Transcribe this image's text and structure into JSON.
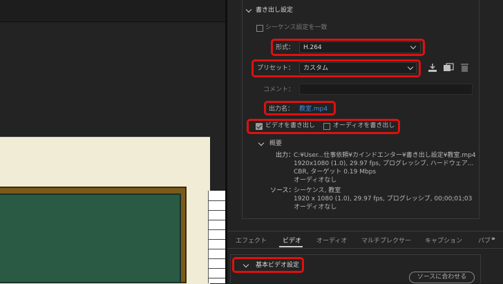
{
  "export_settings": {
    "section_title": "書き出し設定",
    "match_sequence_label": "シーケンス設定を一致",
    "format": {
      "label": "形式：",
      "value": "H.264"
    },
    "preset": {
      "label": "プリセット：",
      "value": "カスタム"
    },
    "comment": {
      "label": "コメント：",
      "value": ""
    },
    "output_name": {
      "label": "出力名：",
      "value": "教室.mp4"
    },
    "export_video": {
      "label": "ビデオを書き出し",
      "checked": true
    },
    "export_audio": {
      "label": "オーディオを書き出し",
      "checked": false
    }
  },
  "summary": {
    "title": "概要",
    "output_label": "出力：",
    "output_lines": [
      "C:¥User...仕事依頼¥カインドエンター¥書き出し設定¥教室.mp4",
      "1920x1080 (1.0), 29.97 fps, プログレッシブ, ハードウェア...",
      "CBR, ターゲット 0.19 Mbps",
      "オーディオなし"
    ],
    "source_label": "ソース：",
    "source_lines": [
      "シーケンス, 教室",
      "1920 x 1080 (1.0), 29.97 fps, プログレッシブ, 00;00;01;03",
      "オーディオなし"
    ]
  },
  "tabs": [
    {
      "label": "エフェクト",
      "active": false
    },
    {
      "label": "ビデオ",
      "active": true
    },
    {
      "label": "オーディオ",
      "active": false
    },
    {
      "label": "マルチプレクサー",
      "active": false
    },
    {
      "label": "キャプション",
      "active": false
    },
    {
      "label": "パブ",
      "active": false
    }
  ],
  "tabs_more_label": "»",
  "basic_video": {
    "section_title": "基本ビデオ設定",
    "match_source_button": "ソースに合わせる"
  },
  "icons": [
    "chevron-down-icon",
    "import-preset-icon",
    "save-preset-icon",
    "trash-icon",
    "checkbox-icon"
  ],
  "colors": {
    "highlight": "#e01010",
    "link": "#3b8ee9",
    "panel": "#232323"
  }
}
